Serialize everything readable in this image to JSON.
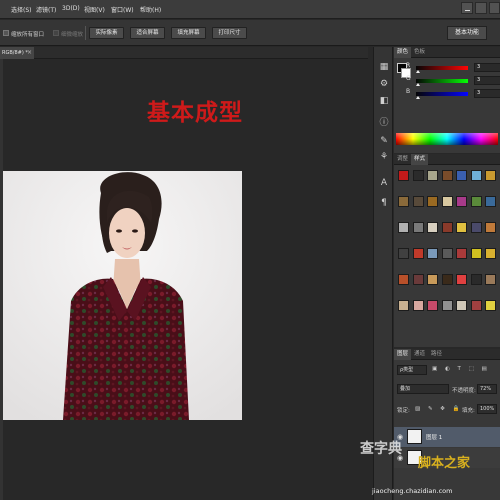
{
  "menubar": {
    "items": [
      "选择(S)",
      "滤镜(T)",
      "3D(D)",
      "视图(V)",
      "窗口(W)",
      "帮助(H)"
    ]
  },
  "options_bar": {
    "check1_label": "缩放所有窗口",
    "check2_label": "细微缩放",
    "buttons": [
      "实际像素",
      "适合屏幕",
      "填充屏幕",
      "打印尺寸"
    ],
    "workspace": "基本功能"
  },
  "document": {
    "tab_label": "RGB/8#) *",
    "close_glyph": "×",
    "heading": "基本成型"
  },
  "color_panel": {
    "tabs": [
      "颜色",
      "色板"
    ],
    "sliders": [
      {
        "letter": "R",
        "value": "3",
        "color": "#d12020"
      },
      {
        "letter": "G",
        "value": "3",
        "color": "#1fb31f"
      },
      {
        "letter": "B",
        "value": "3",
        "color": "#2a3ed6"
      }
    ]
  },
  "styles_panel": {
    "tabs": [
      "调整",
      "样式"
    ]
  },
  "layers_panel": {
    "tabs": [
      "图层",
      "通道",
      "路径"
    ],
    "filter_label": "ρ类型",
    "blend_mode": "叠加",
    "opacity_label": "不透明度:",
    "opacity_value": "72%",
    "lock_label": "锁定:",
    "fill_label": "填充:",
    "fill_value": "100%",
    "layers": [
      {
        "name": "图层 1",
        "selected": true
      },
      {
        "name": "",
        "selected": false
      }
    ]
  },
  "watermark": {
    "text1": "查字典",
    "text2": "脚本之家",
    "url": "jiaocheng.chazidian.com"
  },
  "colors": {
    "heading": "#cf1a1a",
    "workspace_bg": "#282828"
  }
}
